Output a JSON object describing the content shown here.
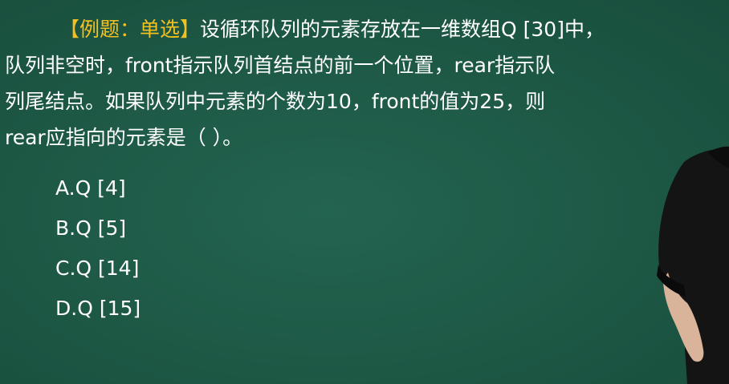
{
  "question": {
    "tag": "【例题：单选】",
    "lines": [
      "设循环队列的元素存放在一维数组Q [30]中，",
      "队列非空时，front指示队列首结点的前一个位置，rear指示队",
      "列尾结点。如果队列中元素的个数为10，front的值为25，则",
      "rear应指向的元素是（    ）。"
    ]
  },
  "options": [
    "A.Q [4]",
    "B.Q [5]",
    "C.Q [14]",
    "D.Q [15]"
  ],
  "colors": {
    "board": "#1f5a47",
    "text": "#ffffff",
    "tag": "#f3c021"
  }
}
